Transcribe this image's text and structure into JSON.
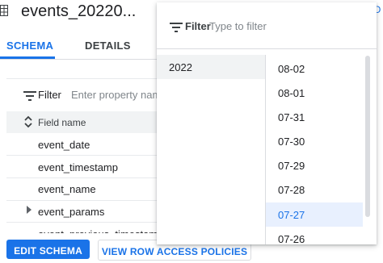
{
  "header": {
    "title": "events_20220...",
    "right_truncated": "O"
  },
  "tabs": [
    {
      "label": "SCHEMA",
      "active": true
    },
    {
      "label": "DETAILS",
      "active": false
    }
  ],
  "schema": {
    "filter_label": "Filter",
    "filter_placeholder": "Enter property name",
    "column_header": "Field name",
    "fields": [
      {
        "name": "event_date"
      },
      {
        "name": "event_timestamp"
      },
      {
        "name": "event_name"
      },
      {
        "name": "event_params",
        "expandable": true
      }
    ],
    "cut_off_row": "event_previous_timestamp"
  },
  "buttons": {
    "edit_schema": "EDIT SCHEMA",
    "view_row_access": "VIEW ROW ACCESS POLICIES"
  },
  "popup": {
    "filter_label": "Filter",
    "filter_placeholder": "Type to filter",
    "years": [
      "2022"
    ],
    "days": [
      "08-02",
      "08-01",
      "07-31",
      "07-30",
      "07-29",
      "07-28",
      "07-27",
      "07-26"
    ],
    "selected_day": "07-27"
  },
  "colors": {
    "accent": "#1a73e8",
    "selected_bg": "#e8f0fe",
    "hover_bg": "#f1f3f4"
  }
}
